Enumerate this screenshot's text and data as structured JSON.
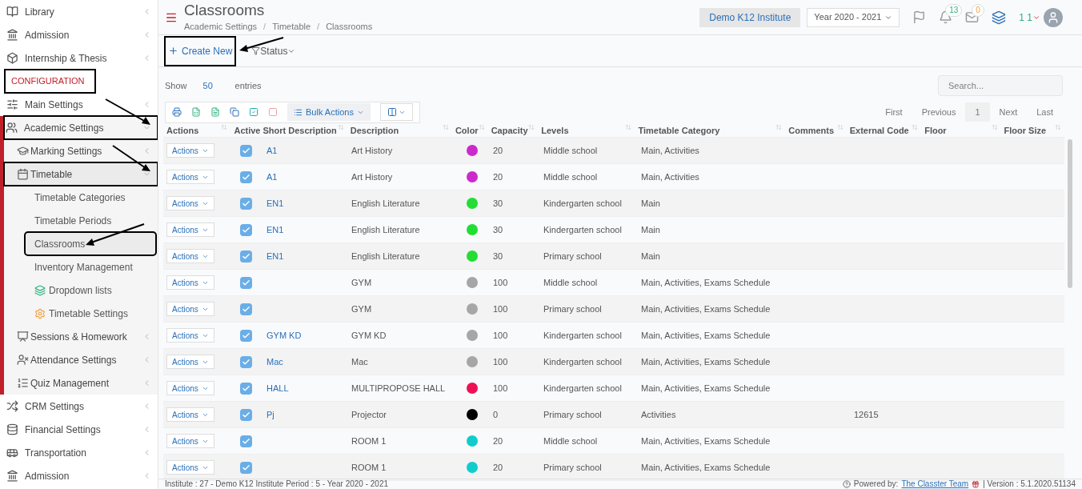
{
  "sidebar": {
    "items": [
      {
        "label": "Library",
        "expanded": false,
        "selected": false,
        "annotated": false
      },
      {
        "label": "Admission",
        "expanded": false,
        "selected": false,
        "annotated": false
      },
      {
        "label": "Internship & Thesis",
        "expanded": false,
        "selected": false,
        "annotated": false
      },
      {
        "kind": "section",
        "label": "CONFIGURATION",
        "annotated": true
      },
      {
        "label": "Main Settings",
        "expanded": false,
        "selected": false,
        "annotated": false
      },
      {
        "label": "Academic Settings",
        "expanded": true,
        "selected": false,
        "annotated": true,
        "children": [
          {
            "label": "Marking Settings",
            "expanded": false,
            "selected": false,
            "annotated": false
          },
          {
            "label": "Timetable",
            "expanded": true,
            "selected": false,
            "annotated": true,
            "children": [
              {
                "label": "Timetable Categories",
                "selected": false,
                "annotated": false
              },
              {
                "label": "Timetable Periods",
                "selected": false,
                "annotated": false
              },
              {
                "label": "Classrooms",
                "selected": true,
                "annotated": true
              },
              {
                "label": "Inventory Management",
                "selected": false,
                "annotated": false
              },
              {
                "label": "Dropdown lists",
                "selected": false,
                "annotated": false
              },
              {
                "label": "Timetable Settings",
                "selected": false,
                "annotated": false
              }
            ]
          },
          {
            "label": "Sessions & Homework",
            "expanded": false,
            "selected": false,
            "annotated": false
          },
          {
            "label": "Attendance Settings",
            "expanded": false,
            "selected": false,
            "annotated": false
          },
          {
            "label": "Quiz Management",
            "expanded": false,
            "selected": false,
            "annotated": false
          }
        ]
      },
      {
        "label": "CRM Settings",
        "expanded": false,
        "selected": false,
        "annotated": false
      },
      {
        "label": "Financial Settings",
        "expanded": false,
        "selected": false,
        "annotated": false
      },
      {
        "label": "Transportation",
        "expanded": false,
        "selected": false,
        "annotated": false
      },
      {
        "label": "Admission",
        "expanded": false,
        "selected": false,
        "annotated": false
      }
    ]
  },
  "header": {
    "title": "Classrooms",
    "breadcrumb": [
      "Academic Settings",
      "Timetable",
      "Classrooms"
    ],
    "breadcrumb_separator": "/",
    "institute": "Demo K12 Institute",
    "year": "Year 2020 - 2021",
    "notifications": "13",
    "messages": "0",
    "user": "1 1"
  },
  "toolbar": {
    "create": "Create New",
    "create_annotated": true,
    "status": "Status"
  },
  "table_controls": {
    "show": "Show",
    "entries_count": "50",
    "entries": "entries",
    "search_placeholder": "Search...",
    "bulk_actions": "Bulk Actions",
    "pagination": [
      {
        "label": "First",
        "selected": false
      },
      {
        "label": "Previous",
        "selected": false
      },
      {
        "label": "1",
        "selected": true
      },
      {
        "label": "Next",
        "selected": false
      },
      {
        "label": "Last",
        "selected": false
      }
    ]
  },
  "table": {
    "columns": [
      "Actions",
      "Active",
      "Short Description",
      "Description",
      "Color",
      "Capacity",
      "Levels",
      "Timetable Category",
      "Comments",
      "External Code",
      "Floor",
      "Floor Size"
    ],
    "rows": [
      {
        "actions": "Actions",
        "active": true,
        "short": "A1",
        "description": "Art History",
        "color": "#cc29cc",
        "capacity": "20",
        "levels": "Middle school",
        "category": "Main, Activities"
      },
      {
        "actions": "Actions",
        "active": true,
        "short": "A1",
        "description": "Art History",
        "color": "#cc29cc",
        "capacity": "20",
        "levels": "Middle school",
        "category": "Main, Activities"
      },
      {
        "actions": "Actions",
        "active": true,
        "short": "EN1",
        "description": "English Literature",
        "color": "#22dd33",
        "capacity": "30",
        "levels": "Kindergarten school",
        "category": "Main"
      },
      {
        "actions": "Actions",
        "active": true,
        "short": "EN1",
        "description": "English Literature",
        "color": "#22dd33",
        "capacity": "30",
        "levels": "Kindergarten school",
        "category": "Main"
      },
      {
        "actions": "Actions",
        "active": true,
        "short": "EN1",
        "description": "English Literature",
        "color": "#22dd33",
        "capacity": "30",
        "levels": "Primary school",
        "category": "Main"
      },
      {
        "actions": "Actions",
        "active": true,
        "description": "GYM",
        "color": "#a6a6a6",
        "capacity": "100",
        "levels": "Middle school",
        "category": "Main, Activities, Exams Schedule"
      },
      {
        "actions": "Actions",
        "active": true,
        "description": "GYM",
        "color": "#a6a6a6",
        "capacity": "100",
        "levels": "Primary school",
        "category": "Main, Activities, Exams Schedule"
      },
      {
        "actions": "Actions",
        "active": true,
        "short": "GYM KD",
        "description": "GYM KD",
        "color": "#a6a6a6",
        "capacity": "100",
        "levels": "Kindergarten school",
        "category": "Main, Activities, Exams Schedule"
      },
      {
        "actions": "Actions",
        "active": true,
        "short": "Mac",
        "description": "Mac",
        "color": "#a6a6a6",
        "capacity": "100",
        "levels": "Kindergarten school",
        "category": "Main, Activities, Exams Schedule"
      },
      {
        "actions": "Actions",
        "active": true,
        "short": "HALL",
        "description": "MULTIPROPOSE HALL",
        "color": "#ee1155",
        "capacity": "100",
        "levels": "Kindergarten school",
        "category": "Main, Activities, Exams Schedule"
      },
      {
        "actions": "Actions",
        "active": true,
        "short": "Pj",
        "description": "Projector",
        "color": "#000000",
        "capacity": "0",
        "levels": "Primary school",
        "category": "Activities",
        "external_code": "12615"
      },
      {
        "actions": "Actions",
        "active": true,
        "description": "ROOM 1",
        "color": "#11cccc",
        "capacity": "20",
        "levels": "Middle school",
        "category": "Main, Activities, Exams Schedule"
      },
      {
        "actions": "Actions",
        "active": true,
        "description": "ROOM 1",
        "color": "#11cccc",
        "capacity": "20",
        "levels": "Primary school",
        "category": "Main, Activities, Exams Schedule"
      }
    ]
  },
  "footer": {
    "left": "Institute : 27 - Demo K12 Institute Period : 5 - Year 2020 - 2021",
    "powered": "Powered by:",
    "team": "The Classter Team",
    "version": "| Version : 5.1.2020.51134"
  }
}
